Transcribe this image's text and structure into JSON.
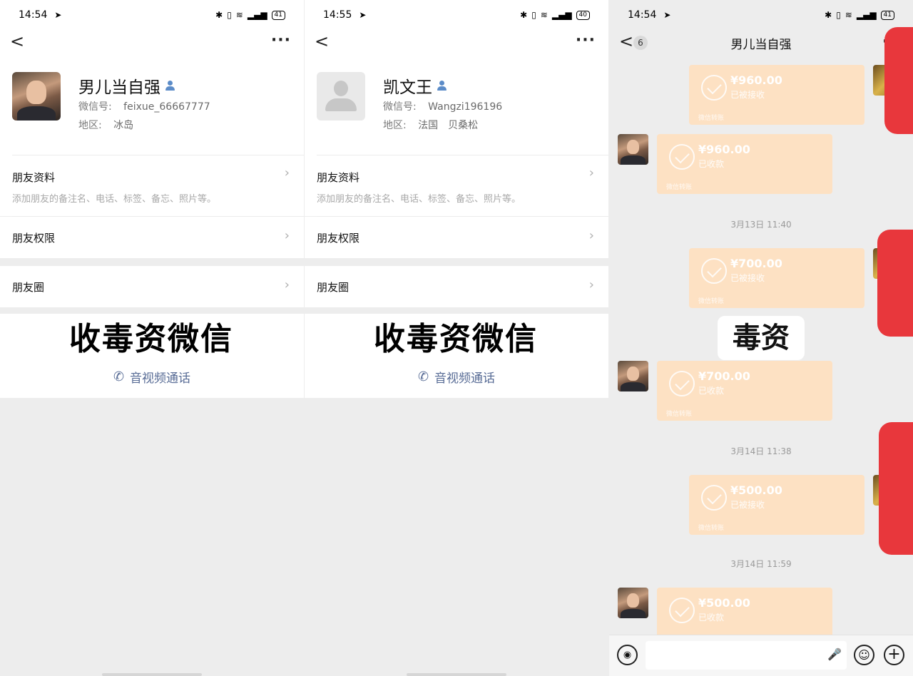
{
  "screens": [
    {
      "status": {
        "time": "14:54",
        "battery": "41"
      },
      "profile": {
        "nickname": "男儿当自强",
        "wechat_id_label": "微信号:",
        "wechat_id": "feixue_66667777",
        "region_label": "地区:",
        "region": "冰岛"
      },
      "rows": {
        "friend_info": "朋友资料",
        "friend_info_sub": "添加朋友的备注名、电话、标签、备忘、照片等。",
        "permissions": "朋友权限",
        "moments": "朋友圈"
      },
      "overlay": "收毒资微信",
      "call": "音视频通话"
    },
    {
      "status": {
        "time": "14:55",
        "battery": "40"
      },
      "profile": {
        "nickname": "凯文王",
        "wechat_id_label": "微信号:",
        "wechat_id": "Wangzi196196",
        "region_label": "地区:",
        "region": "法国　贝桑松"
      },
      "rows": {
        "friend_info": "朋友资料",
        "friend_info_sub": "添加朋友的备注名、电话、标签、备忘、照片等。",
        "permissions": "朋友权限",
        "moments": "朋友圈"
      },
      "overlay": "收毒资微信",
      "call": "音视频通话"
    }
  ],
  "chat": {
    "status": {
      "time": "14:54",
      "battery": "41"
    },
    "unread": "6",
    "title": "男儿当自强",
    "label": "毒资",
    "transfer_footer": "微信转账",
    "messages": [
      {
        "amount": "¥960.00",
        "status": "已被接收"
      },
      {
        "amount": "¥960.00",
        "status": "已收款"
      },
      {
        "amount": "¥700.00",
        "status": "已被接收"
      },
      {
        "amount": "¥700.00",
        "status": "已收款"
      },
      {
        "amount": "¥500.00",
        "status": "已被接收"
      },
      {
        "amount": "¥500.00",
        "status": "已收款"
      }
    ],
    "timestamps": [
      "3月13日 11:40",
      "3月14日 11:38",
      "3月14日 11:59"
    ]
  }
}
